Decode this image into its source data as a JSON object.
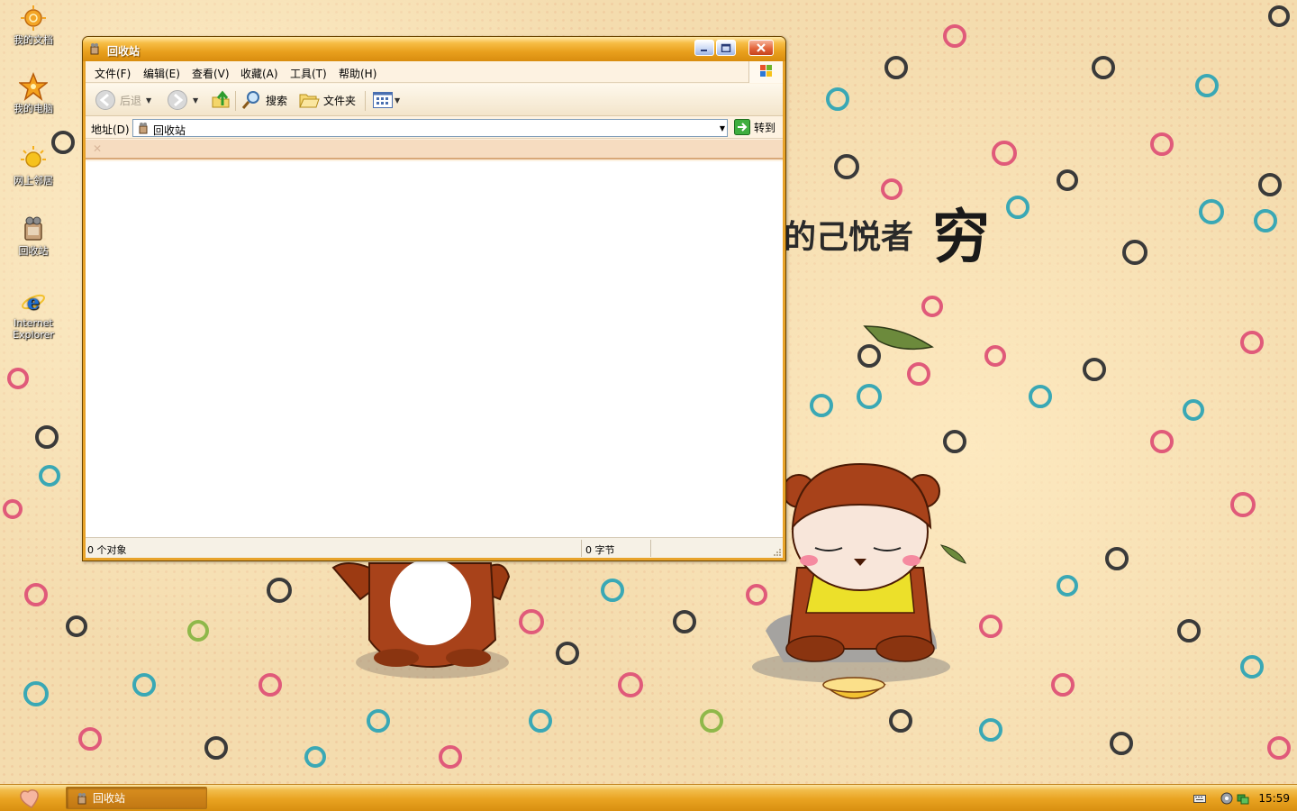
{
  "desktop": {
    "icons": [
      {
        "label": "我的文档",
        "icon": "my-documents-icon"
      },
      {
        "label": "我的电脑",
        "icon": "my-computer-icon"
      },
      {
        "label": "网上邻居",
        "icon": "network-places-icon"
      },
      {
        "label": "回收站",
        "icon": "recycle-bin-icon"
      },
      {
        "label": "Internet\nExplorer",
        "icon": "internet-explorer-icon"
      }
    ],
    "wallpaper_text": "的己悦者",
    "wallpaper_glyph": "穷"
  },
  "window": {
    "title": "回收站",
    "menu": [
      "文件(F)",
      "编辑(E)",
      "查看(V)",
      "收藏(A)",
      "工具(T)",
      "帮助(H)"
    ],
    "toolbar": {
      "back_label": "后退",
      "search_label": "搜索",
      "folders_label": "文件夹"
    },
    "address": {
      "label": "地址(D)",
      "value": "回收站",
      "go_label": "转到"
    },
    "status": {
      "objects": "0 个对象",
      "size": "0 字节"
    }
  },
  "taskbar": {
    "task_label": "回收站",
    "clock": "15:59"
  },
  "colors": {
    "window_frame": "#e8a32a",
    "taskbar": "#e9a321",
    "wallpaper": "#f4dcae"
  }
}
